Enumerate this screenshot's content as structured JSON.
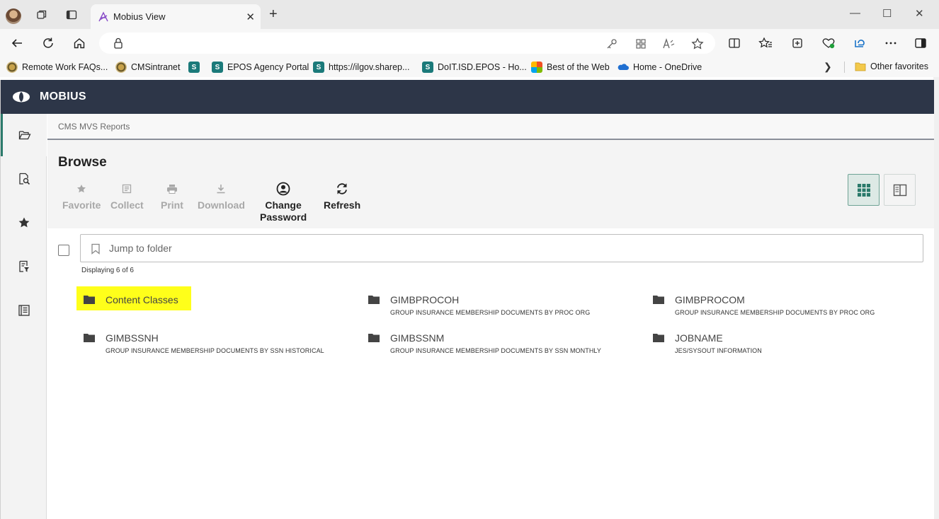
{
  "browser": {
    "tab_title": "Mobius View",
    "tab_close": "✕",
    "new_tab": "+",
    "window_controls": {
      "minimize": "—",
      "maximize": "☐",
      "close": "✕"
    },
    "favorites": [
      {
        "label": "Remote Work FAQs...",
        "icon": "seal-icon"
      },
      {
        "label": "CMSintranet",
        "icon": "seal-icon"
      },
      {
        "label": "",
        "icon": "sharepoint-icon"
      },
      {
        "label": "EPOS Agency Portal",
        "icon": "sharepoint-icon"
      },
      {
        "label": "https://ilgov.sharep...",
        "icon": "sharepoint-icon"
      },
      {
        "label": "DoIT.ISD.EPOS - Ho...",
        "icon": "sharepoint-icon"
      },
      {
        "label": "Best of the Web",
        "icon": "microsoft-icon"
      },
      {
        "label": "Home - OneDrive",
        "icon": "onedrive-icon"
      }
    ],
    "other_favorites": "Other favorites"
  },
  "app": {
    "brand": "MOBIUS",
    "breadcrumb": "CMS MVS Reports",
    "page_title": "Browse",
    "toolbar": {
      "favorite": "Favorite",
      "collect": "Collect",
      "print": "Print",
      "download": "Download",
      "change_password_1": "Change",
      "change_password_2": "Password",
      "refresh": "Refresh"
    },
    "jump_placeholder": "Jump to folder",
    "display_count": "Displaying 6 of 6",
    "folders": [
      {
        "name": "Content Classes",
        "description": "",
        "highlighted": true
      },
      {
        "name": "GIMBPROCOH",
        "description": "GROUP INSURANCE MEMBERSHIP DOCUMENTS BY PROC ORG"
      },
      {
        "name": "GIMBPROCOM",
        "description": "GROUP INSURANCE MEMBERSHIP DOCUMENTS BY PROC ORG"
      },
      {
        "name": "GIMBSSNH",
        "description": "GROUP INSURANCE MEMBERSHIP DOCUMENTS BY SSN HISTORICAL"
      },
      {
        "name": "GIMBSSNM",
        "description": "GROUP INSURANCE MEMBERSHIP DOCUMENTS BY SSN MONTHLY"
      },
      {
        "name": "JOBNAME",
        "description": "JES/SYSOUT INFORMATION"
      }
    ],
    "colors": {
      "header_bg": "#2d3648",
      "accent": "#2b7a6b",
      "highlight": "#ffff1a"
    }
  }
}
